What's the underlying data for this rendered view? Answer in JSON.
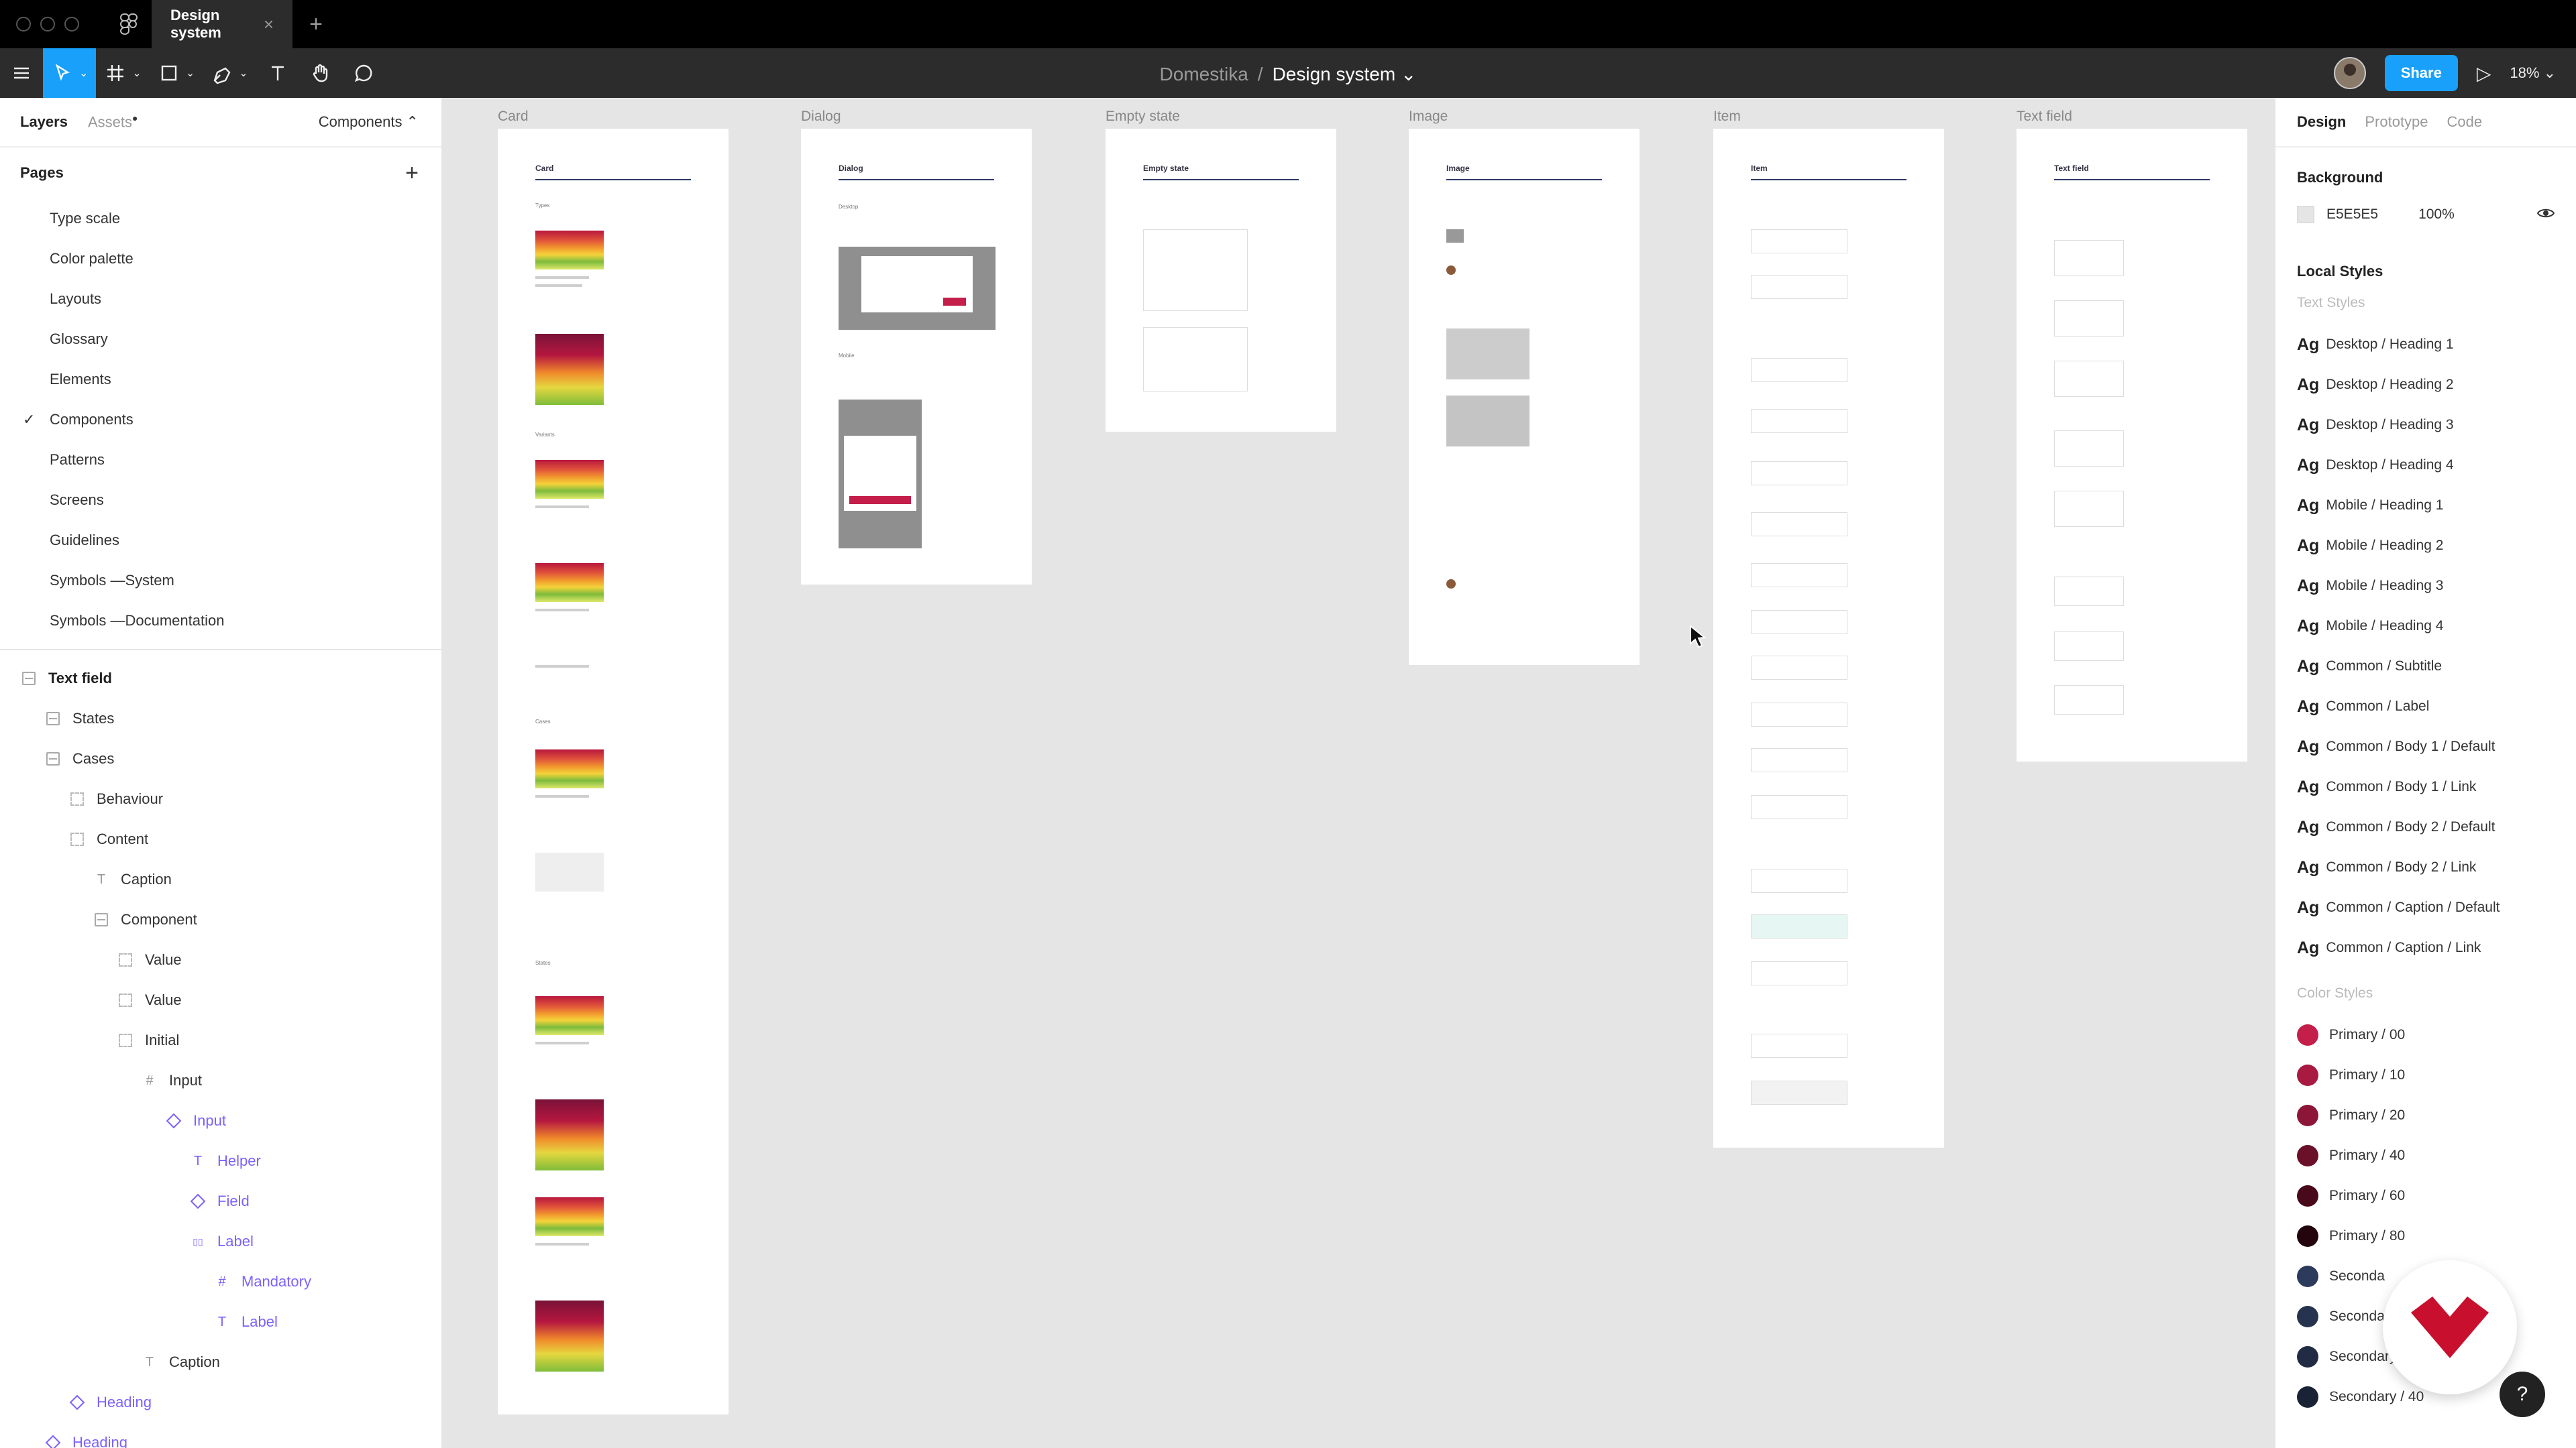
{
  "titlebar": {
    "tab_title": "Design system",
    "tab_close": "×",
    "new_tab": "+"
  },
  "toolbar": {
    "breadcrumb_project": "Domestika",
    "breadcrumb_sep": "/",
    "file_name": "Design system",
    "file_caret": "⌄",
    "share_label": "Share",
    "zoom_label": "18%",
    "zoom_caret": "⌄"
  },
  "left_panel": {
    "tabs": {
      "layers": "Layers",
      "assets": "Assets"
    },
    "page_picker": "Components ⌃",
    "pages_title": "Pages",
    "pages_add": "+",
    "pages": [
      {
        "label": "Type scale",
        "current": false
      },
      {
        "label": "Color palette",
        "current": false
      },
      {
        "label": "Layouts",
        "current": false
      },
      {
        "label": "Glossary",
        "current": false
      },
      {
        "label": "Elements",
        "current": false
      },
      {
        "label": "Components",
        "current": true
      },
      {
        "label": "Patterns",
        "current": false
      },
      {
        "label": "Screens",
        "current": false
      },
      {
        "label": "Guidelines",
        "current": false
      },
      {
        "label": "Symbols —System",
        "current": false
      },
      {
        "label": "Symbols —Documentation",
        "current": false
      }
    ],
    "checkmark": "✓",
    "layers": [
      {
        "label": "Text field",
        "icon": "frame",
        "depth": 0,
        "kind": "bold"
      },
      {
        "label": "States",
        "icon": "frame",
        "depth": 1,
        "kind": "normal"
      },
      {
        "label": "Cases",
        "icon": "frame",
        "depth": 1,
        "kind": "normal"
      },
      {
        "label": "Behaviour",
        "icon": "dash",
        "depth": 2,
        "kind": "normal"
      },
      {
        "label": "Content",
        "icon": "dash",
        "depth": 2,
        "kind": "normal"
      },
      {
        "label": "Caption",
        "icon": "text",
        "depth": 3,
        "kind": "normal"
      },
      {
        "label": "Component",
        "icon": "frame",
        "depth": 3,
        "kind": "normal"
      },
      {
        "label": "Value",
        "icon": "dash",
        "depth": 4,
        "kind": "normal"
      },
      {
        "label": "Value",
        "icon": "dash",
        "depth": 4,
        "kind": "normal"
      },
      {
        "label": "Initial",
        "icon": "dash",
        "depth": 4,
        "kind": "normal"
      },
      {
        "label": "Input",
        "icon": "hash",
        "depth": 5,
        "kind": "normal"
      },
      {
        "label": "Input",
        "icon": "diamond",
        "depth": 6,
        "kind": "comp"
      },
      {
        "label": "Helper",
        "icon": "text",
        "depth": 7,
        "kind": "comp"
      },
      {
        "label": "Field",
        "icon": "diamond",
        "depth": 7,
        "kind": "comp"
      },
      {
        "label": "Label",
        "icon": "columns",
        "depth": 7,
        "kind": "comp"
      },
      {
        "label": "Mandatory",
        "icon": "hash",
        "depth": 8,
        "kind": "comp"
      },
      {
        "label": "Label",
        "icon": "text",
        "depth": 8,
        "kind": "comp"
      },
      {
        "label": "Caption",
        "icon": "text",
        "depth": 5,
        "kind": "normal"
      },
      {
        "label": "Heading",
        "icon": "diamond",
        "depth": 2,
        "kind": "comp"
      },
      {
        "label": "Heading",
        "icon": "diamond",
        "depth": 1,
        "kind": "comp"
      }
    ]
  },
  "canvas": {
    "frames": [
      {
        "label": "Card",
        "title": "Card"
      },
      {
        "label": "Dialog",
        "title": "Dialog"
      },
      {
        "label": "Empty state",
        "title": "Empty state"
      },
      {
        "label": "Image",
        "title": "Image"
      },
      {
        "label": "Item",
        "title": "Item"
      },
      {
        "label": "Text field",
        "title": "Text field"
      }
    ]
  },
  "right_panel": {
    "tabs": {
      "design": "Design",
      "prototype": "Prototype",
      "code": "Code"
    },
    "background_title": "Background",
    "background_hex": "E5E5E5",
    "background_opacity": "100%",
    "background_color": "#e5e5e5",
    "local_styles_title": "Local Styles",
    "text_styles_title": "Text Styles",
    "text_style_glyph": "Ag",
    "text_styles": [
      "Desktop / Heading 1",
      "Desktop / Heading 2",
      "Desktop / Heading 3",
      "Desktop / Heading 4",
      "Mobile / Heading 1",
      "Mobile / Heading 2",
      "Mobile / Heading 3",
      "Mobile / Heading 4",
      "Common / Subtitle",
      "Common / Label",
      "Common / Body 1 / Default",
      "Common / Body 1 / Link",
      "Common / Body 2 / Default",
      "Common / Body 2 / Link",
      "Common / Caption / Default",
      "Common / Caption / Link"
    ],
    "color_styles_title": "Color Styles",
    "color_styles": [
      {
        "name": "Primary / 00",
        "color": "#c41e4a"
      },
      {
        "name": "Primary / 10",
        "color": "#a81a41"
      },
      {
        "name": "Primary / 20",
        "color": "#8d1638"
      },
      {
        "name": "Primary / 40",
        "color": "#6a1029"
      },
      {
        "name": "Primary / 60",
        "color": "#48091b"
      },
      {
        "name": "Primary / 80",
        "color": "#24040d"
      },
      {
        "name": "Seconda",
        "color": "#2c3a5c"
      },
      {
        "name": "Secondar",
        "color": "#26334f"
      },
      {
        "name": "Secondary / 20",
        "color": "#212b44"
      },
      {
        "name": "Secondary / 40",
        "color": "#1a2236"
      }
    ]
  },
  "help_label": "?",
  "colors": {
    "accent": "#18a0fb",
    "brand_red": "#c8102e",
    "component_purple": "#7b61ff"
  }
}
